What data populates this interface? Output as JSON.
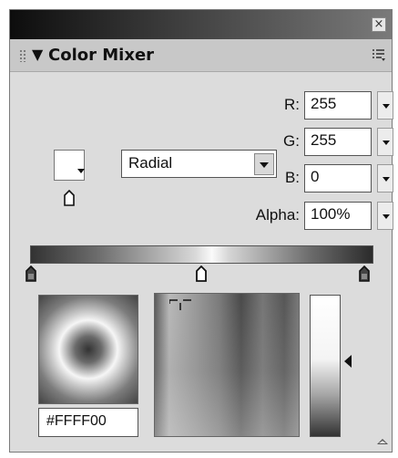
{
  "panel": {
    "title": "Color Mixer",
    "close_glyph": "×",
    "collapse_glyph": "▼"
  },
  "icons": {
    "close": "close-icon",
    "collapse": "triangle-down-icon",
    "options": "options-menu-icon",
    "grip": "grip-icon",
    "stroke_fill": "fill-swatch-icon",
    "paint_bucket": "pointer-icon",
    "expand": "expand-icon"
  },
  "rgba": {
    "r_label": "R:",
    "r_value": "255",
    "g_label": "G:",
    "g_value": "255",
    "b_label": "B:",
    "b_value": "0",
    "alpha_label": "Alpha:",
    "alpha_value": "100%"
  },
  "fill": {
    "type": "Radial"
  },
  "gradient": {
    "stops": [
      {
        "position": 0.0,
        "color": "#2b2b2b"
      },
      {
        "position": 0.5,
        "color": "#ffffff"
      },
      {
        "position": 1.0,
        "color": "#2b2b2b"
      }
    ]
  },
  "hex": {
    "value": "#FFFF00"
  },
  "colors": {
    "panel_bg": "#dcdcdc",
    "header_bg": "#c8c8c8",
    "titlebar_start": "#0d0d0d"
  }
}
